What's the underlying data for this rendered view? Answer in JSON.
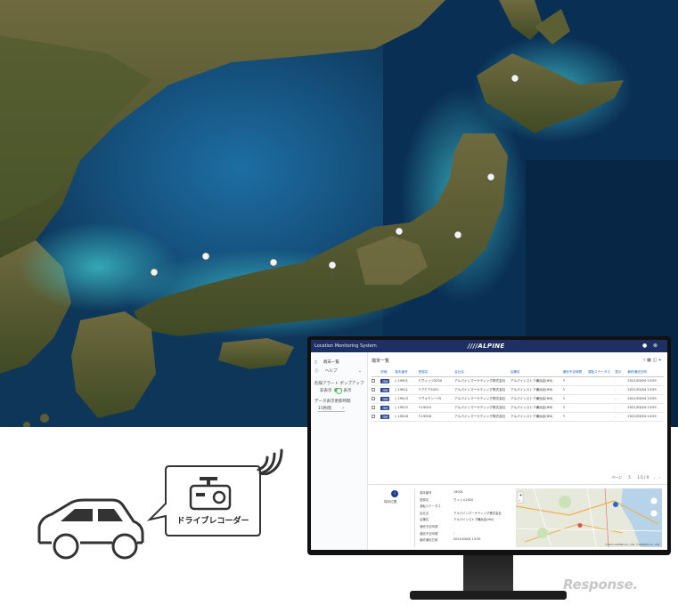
{
  "app": {
    "title": "Location Monitoring System",
    "logo": "////ALPINE"
  },
  "sidebar": {
    "items": [
      {
        "label": "端末一覧",
        "icon": "phone-icon"
      },
      {
        "label": "ヘルプ",
        "icon": "help-icon"
      }
    ],
    "alert_popup_label": "危険アラート ポップアップ",
    "toggle_off": "非表示",
    "toggle_on": "表示",
    "data_interval_label": "データ表示更新時間",
    "data_interval_value": "15秒間"
  },
  "main": {
    "title": "端末一覧",
    "columns": [
      "詳細",
      "端末番号",
      "登録名",
      "会社名",
      "店舗名",
      "通信予定時間",
      "運転ステータス",
      "表示",
      "最終通信日時"
    ],
    "rows": [
      {
        "detail": "詳細",
        "id": "19001",
        "name": "ヴィッツ2020",
        "company": "アルパインマーケティング株式会社",
        "store": "アルパインストア横浜店(HN)",
        "last": "2021/03/04 13:59"
      },
      {
        "detail": "詳細",
        "id": "19011",
        "name": "アクア2021",
        "company": "アルパインマーケティング株式会社",
        "store": "アルパインストア横浜店(HN)",
        "last": "2021/03/04 13:59"
      },
      {
        "detail": "詳細",
        "id": "19013",
        "name": "ヴォクシー7V",
        "company": "アルパインマーケティング株式会社",
        "store": "アルパインストア横浜店(HN)",
        "last": "2021/03/04 13:59"
      },
      {
        "detail": "詳細",
        "id": "19015",
        "name": "19015",
        "company": "アルパインマーケティング株式会社",
        "store": "アルパインストア横浜店(HN)",
        "last": "2021/03/04 13:59"
      },
      {
        "detail": "詳細",
        "id": "19018",
        "name": "19018",
        "company": "アルパインマーケティング株式会社",
        "store": "アルパインストア横浜店(HN)",
        "last": "2021/03/04 13:59"
      }
    ],
    "pager": {
      "per_page_label": "ページ",
      "per_page": "5",
      "range": "1-5 / 9"
    }
  },
  "detail": {
    "panel_label": "端末位置",
    "fields": [
      {
        "key": "端末番号",
        "value": "19001"
      },
      {
        "key": "登録名",
        "value": "ヴィッツ2020"
      },
      {
        "key": "運転ステータス",
        "value": ""
      },
      {
        "key": "会社名",
        "value": "アルパインマーケティング株式会社"
      },
      {
        "key": "店舗名",
        "value": "アルパインストア横浜店(HN)"
      },
      {
        "key": "通信予定時間",
        "value": ""
      },
      {
        "key": "通信予定時間",
        "value": "-"
      },
      {
        "key": "最終通信日時",
        "value": "2021/03/04 13:59"
      }
    ],
    "map_copyright": "©2021 ALPINE CO., LTD. ©ZENRIN CO., LTD."
  },
  "illustration": {
    "device_label": "ドライブレコーダー",
    "car_icon": "car-icon",
    "camera_icon": "dashcam-icon",
    "signal_icon": "wifi-signal-icon"
  },
  "watermark": "Response."
}
